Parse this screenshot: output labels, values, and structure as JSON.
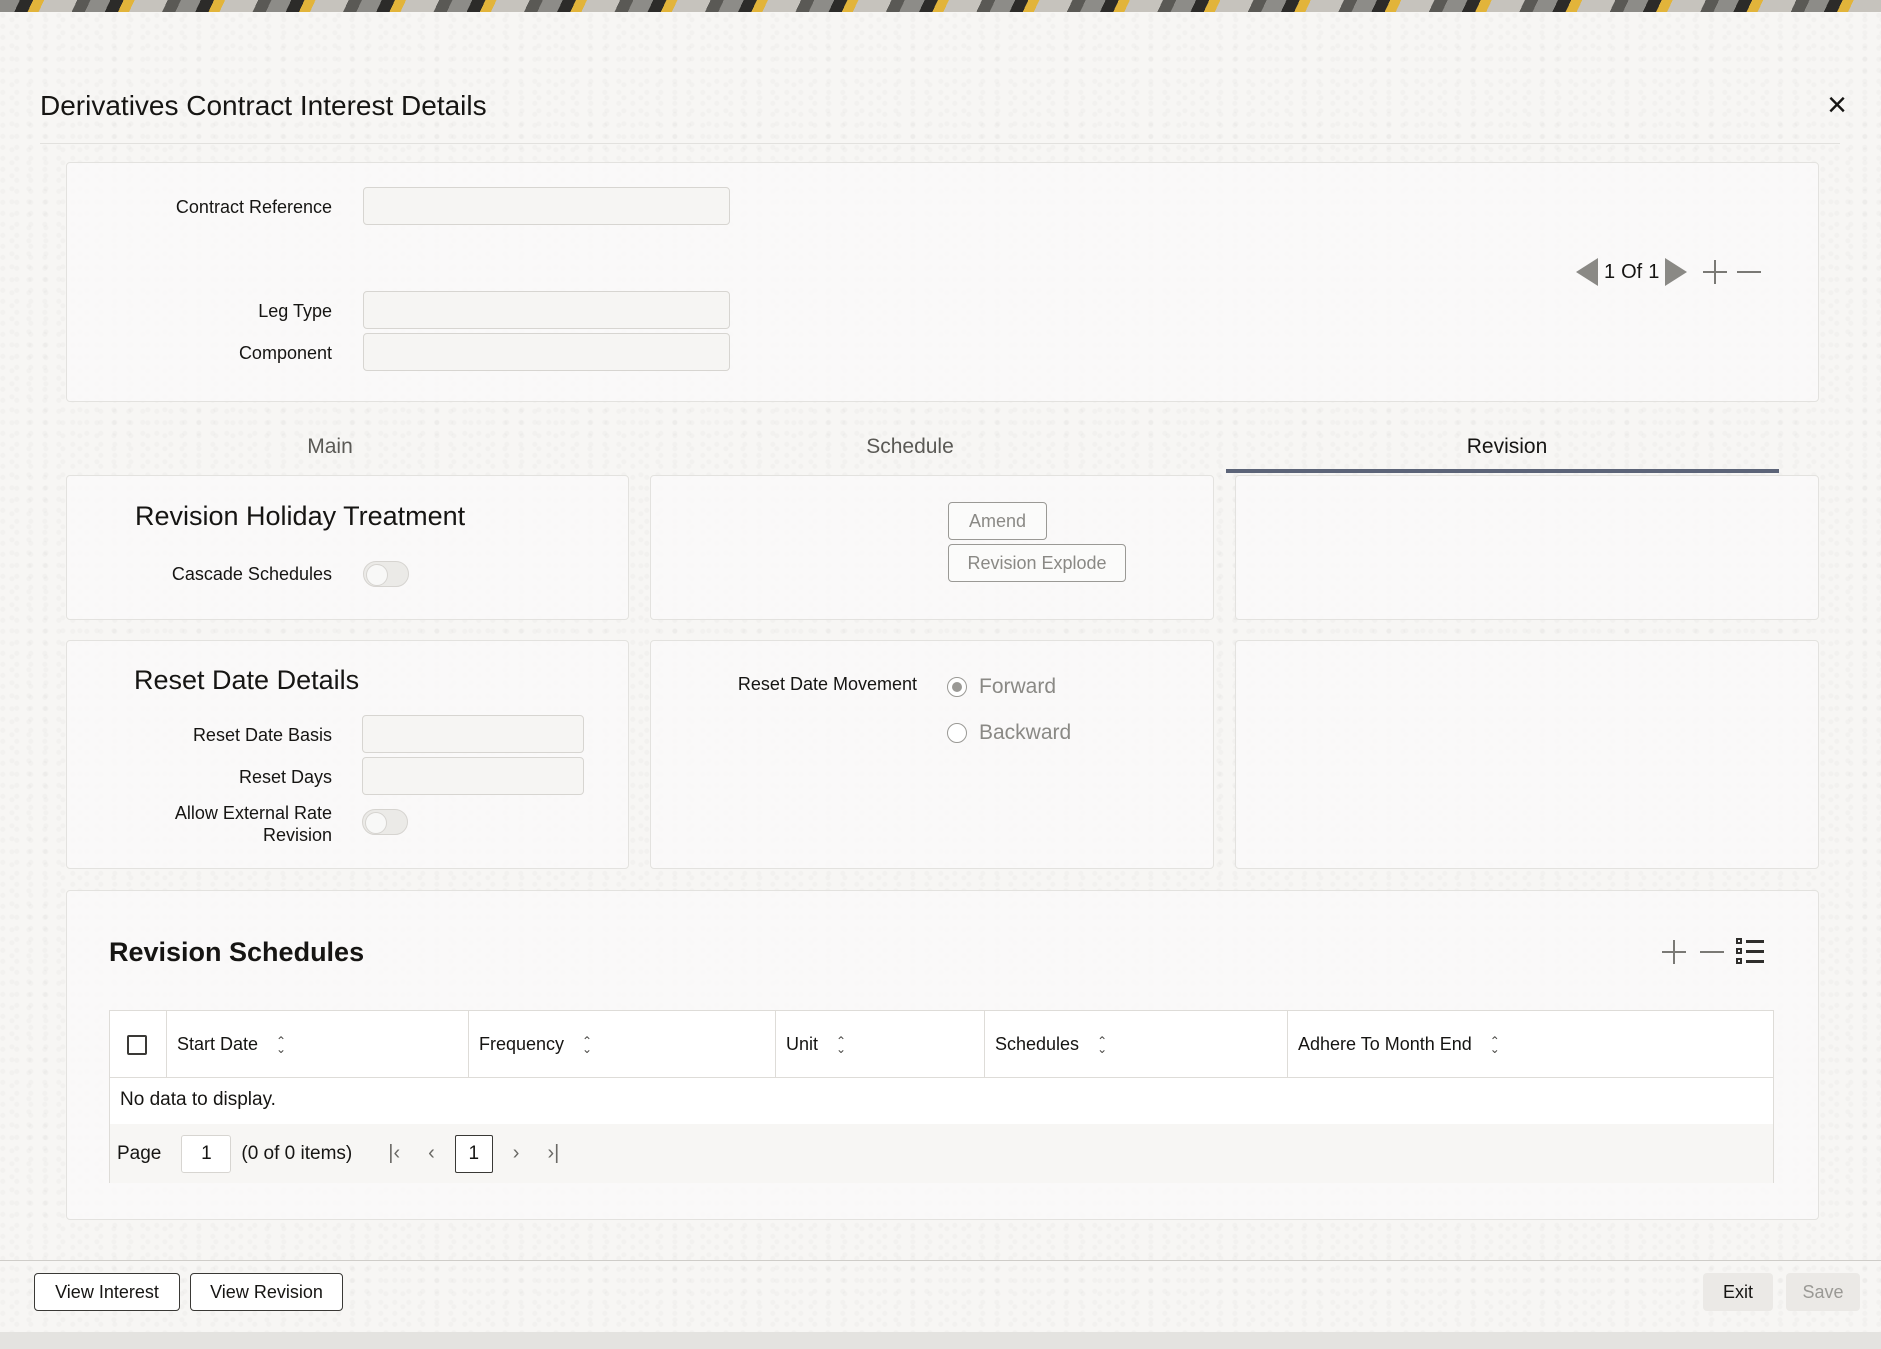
{
  "window": {
    "title": "Derivatives Contract Interest Details",
    "close_icon": "close-icon"
  },
  "header_form": {
    "contract_reference_label": "Contract Reference",
    "contract_reference_value": "",
    "leg_type_label": "Leg Type",
    "leg_type_value": "",
    "component_label": "Component",
    "component_value": "",
    "record_pager": {
      "current": "1",
      "of_label": "Of",
      "total": "1"
    }
  },
  "tabs": [
    {
      "label": "Main",
      "active": false
    },
    {
      "label": "Schedule",
      "active": false
    },
    {
      "label": "Revision",
      "active": true
    }
  ],
  "revision_holiday": {
    "title": "Revision Holiday Treatment",
    "cascade_label": "Cascade Schedules",
    "cascade_on": false
  },
  "actions": {
    "amend_label": "Amend",
    "revision_explode_label": "Revision Explode"
  },
  "reset_date": {
    "title": "Reset Date Details",
    "basis_label": "Reset Date Basis",
    "basis_value": "",
    "days_label": "Reset Days",
    "days_value": "",
    "allow_ext_label_line1": "Allow External Rate",
    "allow_ext_label_line2": "Revision",
    "allow_ext_on": false,
    "movement_label": "Reset Date Movement",
    "movement_options": [
      "Forward",
      "Backward"
    ],
    "movement_selected": "Forward"
  },
  "revision_schedules": {
    "title": "Revision Schedules",
    "columns": [
      "Start Date",
      "Frequency",
      "Unit",
      "Schedules",
      "Adhere To Month End"
    ],
    "rows": [],
    "empty_message": "No data to display.",
    "pagination": {
      "page_label": "Page",
      "page_value": "1",
      "items_text": "(0 of 0 items)",
      "current_page": "1"
    }
  },
  "footer": {
    "view_interest_label": "View Interest",
    "view_revision_label": "View Revision",
    "exit_label": "Exit",
    "save_label": "Save"
  },
  "colors": {
    "tab_underline": "#5c6478",
    "disabled_text": "#8a8985"
  }
}
